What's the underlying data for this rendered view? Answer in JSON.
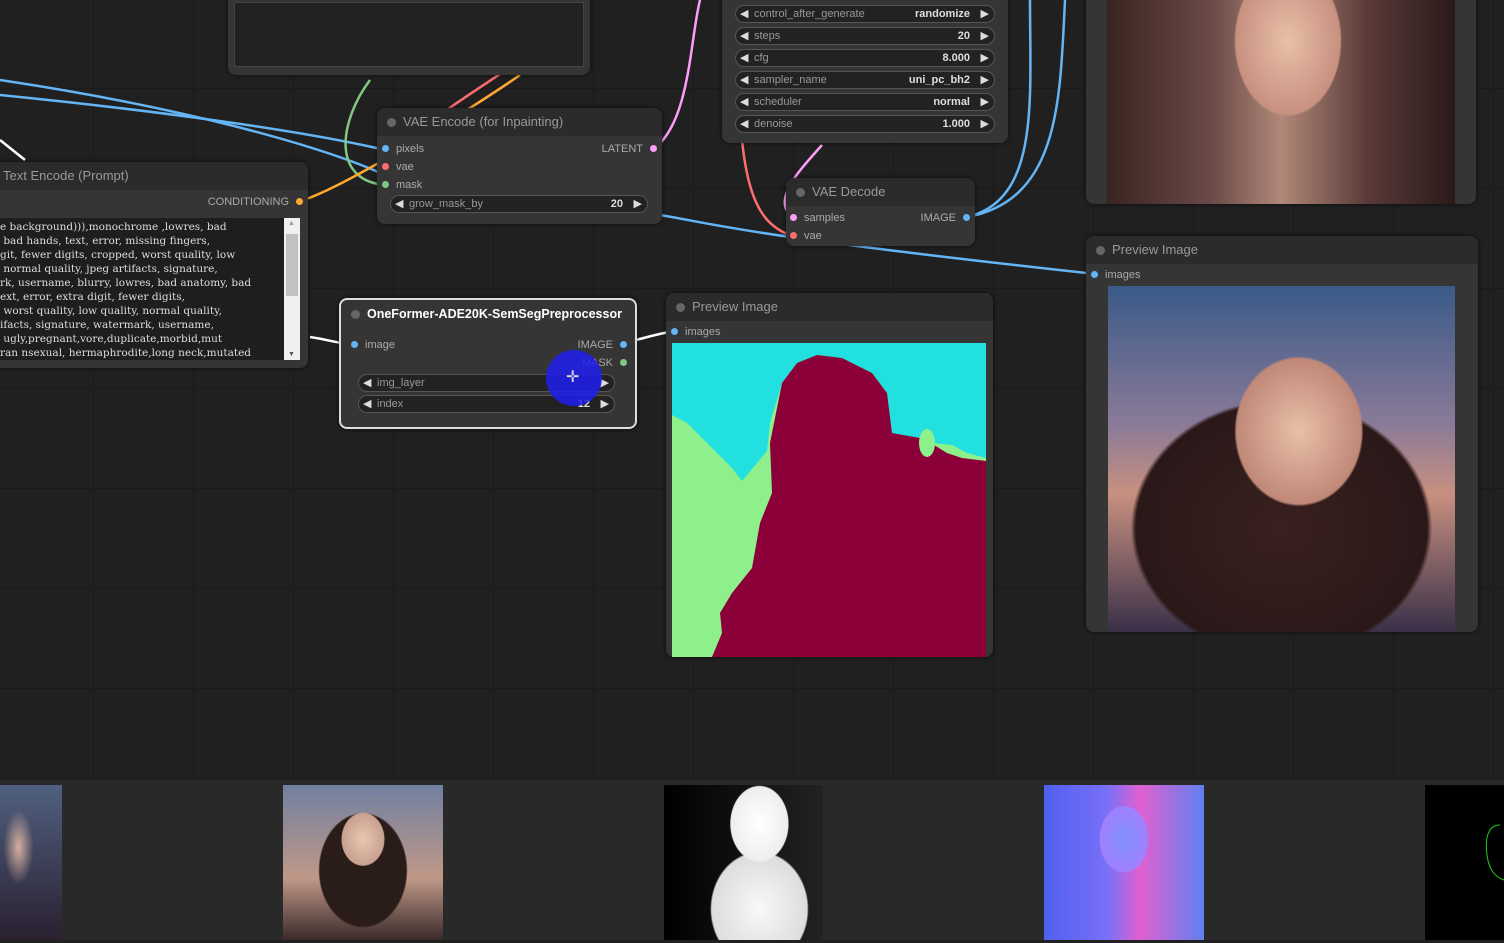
{
  "nodes": {
    "vae_encode": {
      "title": "VAE Encode (for Inpainting)",
      "inputs": [
        "pixels",
        "vae",
        "mask"
      ],
      "output": "LATENT",
      "widget": {
        "name": "grow_mask_by",
        "value": "20"
      }
    },
    "text_encode": {
      "title": "Text Encode (Prompt)",
      "output": "CONDITIONING",
      "lines": [
        "e background))),monochrome ,lowres, bad",
        " bad hands, text, error, missing fingers,",
        "git, fewer digits, cropped, worst quality, low",
        " normal quality, jpeg artifacts, signature,",
        "rk, username, blurry, lowres, bad anatomy, bad",
        "ext, error, extra digit, fewer digits,",
        " worst quality, low quality, normal quality,",
        "ifacts, signature, watermark, username,",
        " ugly,pregnant,vore,duplicate,morbid,mut",
        "ran nsexual, hermaphrodite,long neck,mutated"
      ]
    },
    "ksampler": {
      "widgets": [
        {
          "name": "control_after_generate",
          "value": "randomize"
        },
        {
          "name": "steps",
          "value": "20"
        },
        {
          "name": "cfg",
          "value": "8.000"
        },
        {
          "name": "sampler_name",
          "value": "uni_pc_bh2"
        },
        {
          "name": "scheduler",
          "value": "normal"
        },
        {
          "name": "denoise",
          "value": "1.000"
        }
      ]
    },
    "vae_decode": {
      "title": "VAE Decode",
      "inputs": [
        "samples",
        "vae"
      ],
      "output": "IMAGE"
    },
    "oneformer": {
      "title": "OneFormer-ADE20K-SemSegPreprocessor",
      "input": "image",
      "outputs": [
        "IMAGE",
        "MASK"
      ],
      "widgets": [
        {
          "name": "img_layer",
          "value": ""
        },
        {
          "name": "index",
          "value": "12"
        }
      ]
    },
    "preview_mid": {
      "title": "Preview Image",
      "input": "images"
    },
    "preview_right": {
      "title": "Preview Image",
      "input": "images"
    }
  },
  "colors": {
    "image": "#64b5f6",
    "vae": "#ff6e6e",
    "mask": "#81c784",
    "latent": "#ff9cf9",
    "conditioning": "#ffa931",
    "seg_sky": "#22e0e0",
    "seg_person": "#8c0039",
    "seg_tree": "#8ef08a"
  }
}
